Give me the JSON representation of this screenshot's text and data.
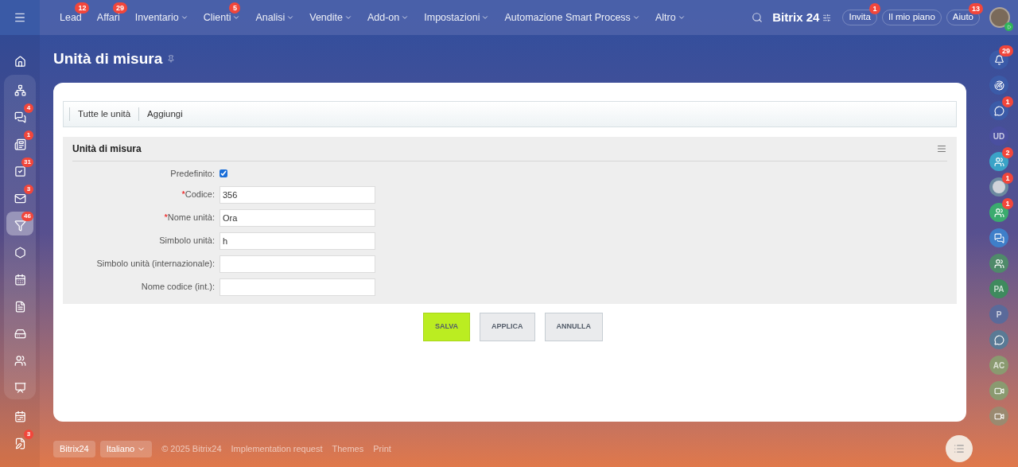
{
  "top_nav": {
    "menu_items": [
      {
        "label": "Lead",
        "badge": "12",
        "dropdown": false
      },
      {
        "label": "Affari",
        "badge": "29",
        "dropdown": false
      },
      {
        "label": "Inventario",
        "dropdown": true
      },
      {
        "label": "Clienti",
        "badge": "5",
        "dropdown": true
      },
      {
        "label": "Analisi",
        "dropdown": true
      },
      {
        "label": "Vendite",
        "dropdown": true
      },
      {
        "label": "Add-on",
        "dropdown": true
      },
      {
        "label": "Impostazioni",
        "dropdown": true
      },
      {
        "label": "Automazione Smart Process",
        "dropdown": true
      },
      {
        "label": "Altro",
        "dropdown": true
      }
    ],
    "brand": "Bitrix 24",
    "buttons": [
      {
        "label": "Invita",
        "badge": "1"
      },
      {
        "label": "Il mio piano"
      },
      {
        "label": "Aiuto",
        "badge": "13"
      }
    ]
  },
  "left_sidebar": {
    "items": [
      {
        "selected": false
      },
      {
        "selected": false,
        "children": [
          {
            "selected": false
          },
          {
            "badge": "4",
            "selected": false
          },
          {
            "badge": "1",
            "selected": false
          },
          {
            "badge": "31",
            "selected": false
          },
          {
            "badge": "3",
            "selected": false
          },
          {
            "badge": "46",
            "selected": true
          },
          {
            "selected": false
          },
          {
            "selected": false
          },
          {
            "selected": false
          },
          {
            "selected": false
          },
          {
            "selected": false
          },
          {
            "selected": false
          }
        ]
      },
      {
        "selected": false
      },
      {
        "badge": "3",
        "selected": false
      }
    ]
  },
  "page_title": "Unità di misura",
  "toolbar": [
    "Tutte le unità",
    "Aggiungi"
  ],
  "form": {
    "title": "Unità di misura",
    "fields": [
      {
        "kind": "checkbox",
        "label": "Predefinito:",
        "checked": true
      },
      {
        "kind": "text",
        "label": "Codice:",
        "required_mark": "*",
        "value": "356"
      },
      {
        "kind": "text",
        "label": "Nome unità:",
        "required_mark": "*",
        "value": "Ora"
      },
      {
        "kind": "text",
        "label": "Simbolo unità:",
        "value": "h"
      },
      {
        "kind": "text",
        "label": "Simbolo unità (internazionale):"
      },
      {
        "kind": "text",
        "label": "Nome codice (int.):"
      }
    ]
  },
  "buttons": [
    {
      "label": "SALVA",
      "kind": "primary"
    },
    {
      "label": "APPLICA",
      "kind": "secondary"
    },
    {
      "label": "ANNULLA",
      "kind": "secondary"
    }
  ],
  "footer": {
    "brand": "Bitrix24",
    "language": "Italiano",
    "copyright": "© 2025 Bitrix24",
    "links": [
      "Implementation request",
      "Themes",
      "Print"
    ]
  },
  "right_sidebar": {
    "items": [
      {
        "kind": "icon",
        "badge": "29",
        "color": "#3b5ba8"
      },
      {
        "kind": "icon",
        "color": "#3b5ba8"
      },
      {
        "kind": "icon",
        "badge": "1",
        "color": "#3b5ba8"
      },
      {
        "kind": "initials",
        "initials": "UD",
        "color": "#4a4fa0"
      },
      {
        "kind": "group",
        "badge": "2",
        "color": "#3aa3c7"
      },
      {
        "kind": "avatar",
        "badge": "1",
        "color": "#6b8aa0"
      },
      {
        "kind": "group",
        "badge": "1",
        "color": "#3bab6e"
      },
      {
        "kind": "chat",
        "color": "#3f7fc9"
      },
      {
        "kind": "group",
        "color": "#4f8a6a"
      },
      {
        "kind": "initials",
        "initials": "PA",
        "color": "#3f8a5e"
      },
      {
        "kind": "initials",
        "initials": "P",
        "color": "#5a6a9a"
      },
      {
        "kind": "icon",
        "color": "#5a7a95"
      },
      {
        "kind": "initials",
        "initials": "AC",
        "color": "#8a9a70"
      },
      {
        "kind": "video",
        "color": "#8a9a70"
      },
      {
        "kind": "video",
        "color": "#9a8a70"
      }
    ]
  }
}
